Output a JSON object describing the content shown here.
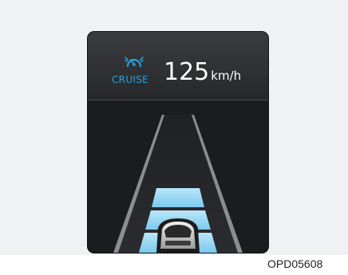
{
  "cluster": {
    "mode_label": "CRUISE",
    "mode_icon": "cruise-control-icon",
    "speed_value": "125",
    "speed_unit": "km/h",
    "distance_level_bars": 3,
    "colors": {
      "cruise_accent": "#23a2dd",
      "bar": "#8fd4f4",
      "screen_bg": "#1b1c1e"
    }
  },
  "figure": {
    "caption": "OPD05608"
  }
}
